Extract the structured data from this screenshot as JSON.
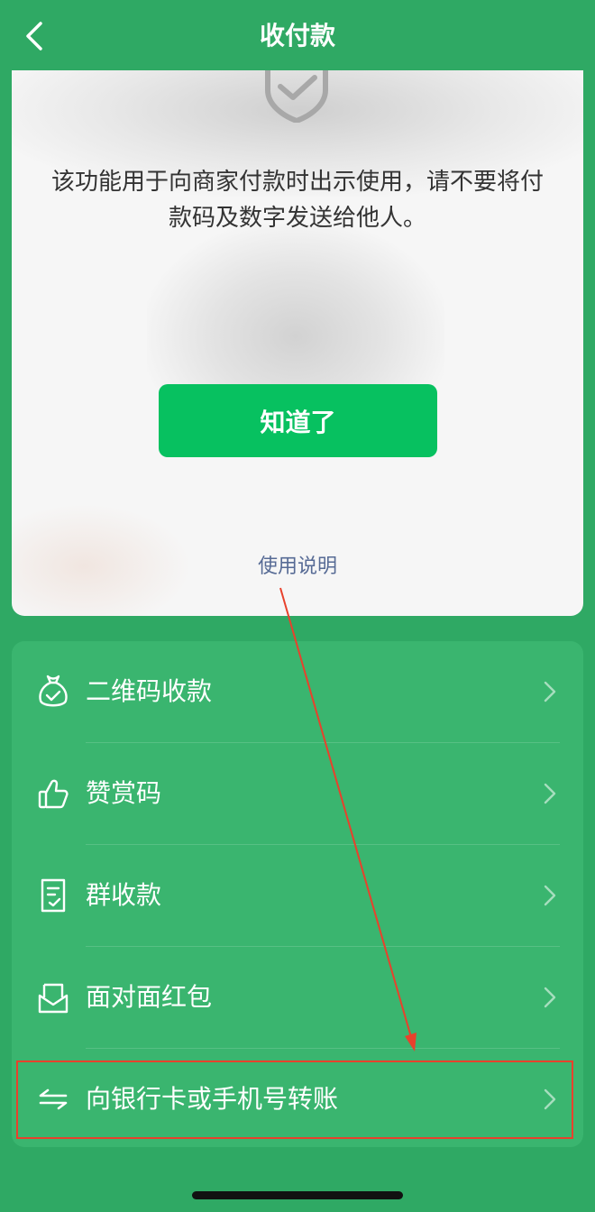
{
  "header": {
    "title": "收付款",
    "back_icon": "chevron-left-icon"
  },
  "notice_card": {
    "icon": "shield-check-icon",
    "message": "该功能用于向商家付款时出示使用，请不要将付款码及数字发送给他人。",
    "confirm_label": "知道了",
    "help_link": "使用说明"
  },
  "menu": {
    "items": [
      {
        "label": "二维码收款",
        "icon": "money-bag-icon"
      },
      {
        "label": "赞赏码",
        "icon": "thumbs-up-icon"
      },
      {
        "label": "群收款",
        "icon": "receipt-icon"
      },
      {
        "label": "面对面红包",
        "icon": "red-packet-icon"
      },
      {
        "label": "向银行卡或手机号转账",
        "icon": "transfer-arrows-icon"
      }
    ]
  },
  "annotation": {
    "highlight_color": "#e8412c",
    "highlighted_item": "向银行卡或手机号转账"
  },
  "colors": {
    "brand_green": "#2fa964",
    "button_green": "#07c160",
    "link_blue": "#576b95"
  }
}
